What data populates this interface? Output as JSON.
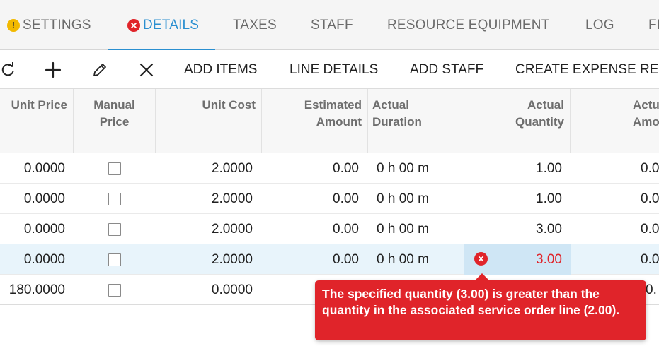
{
  "tabs": [
    {
      "label": "SETTINGS",
      "status": "warning"
    },
    {
      "label": "DETAILS",
      "status": "error",
      "active": true
    },
    {
      "label": "TAXES"
    },
    {
      "label": "STAFF"
    },
    {
      "label": "RESOURCE EQUIPMENT"
    },
    {
      "label": "LOG"
    },
    {
      "label": "FI"
    }
  ],
  "toolbar": {
    "refresh_icon": "refresh-icon",
    "add_icon": "plus-icon",
    "edit_icon": "pencil-icon",
    "delete_icon": "close-icon",
    "add_items": "ADD ITEMS",
    "line_details": "LINE DETAILS",
    "add_staff": "ADD STAFF",
    "create_expense": "CREATE EXPENSE RE"
  },
  "columns": {
    "unit_price": "Unit Price",
    "manual_price_1": "Manual",
    "manual_price_2": "Price",
    "unit_cost": "Unit Cost",
    "estimated_amount_1": "Estimated",
    "estimated_amount_2": "Amount",
    "actual_duration_1": "Actual",
    "actual_duration_2": "Duration",
    "actual_quantity_1": "Actual",
    "actual_quantity_2": "Quantity",
    "actual_amount_1": "Actu",
    "actual_amount_2": "Amou"
  },
  "rows": [
    {
      "unit_price": "0.0000",
      "unit_cost": "2.0000",
      "estimated_amount": "0.00",
      "actual_duration": "0 h 00 m",
      "actual_quantity": "1.00",
      "actual_amount": "0.0"
    },
    {
      "unit_price": "0.0000",
      "unit_cost": "2.0000",
      "estimated_amount": "0.00",
      "actual_duration": "0 h 00 m",
      "actual_quantity": "1.00",
      "actual_amount": "0.0"
    },
    {
      "unit_price": "0.0000",
      "unit_cost": "2.0000",
      "estimated_amount": "0.00",
      "actual_duration": "0 h 00 m",
      "actual_quantity": "3.00",
      "actual_amount": "0.0"
    },
    {
      "unit_price": "0.0000",
      "unit_cost": "2.0000",
      "estimated_amount": "0.00",
      "actual_duration": "0 h 00 m",
      "actual_quantity": "3.00",
      "actual_amount": "0.0"
    },
    {
      "unit_price": "180.0000",
      "unit_cost": "0.0000",
      "estimated_amount": "",
      "actual_duration": "",
      "actual_quantity": "",
      "actual_amount": "0."
    }
  ],
  "error_tooltip": "The specified quantity (3.00) is greater than the quantity in the associated service order line (2.00).",
  "colors": {
    "accent": "#2a8fd0",
    "error": "#e0242a",
    "warning": "#f2b900"
  }
}
